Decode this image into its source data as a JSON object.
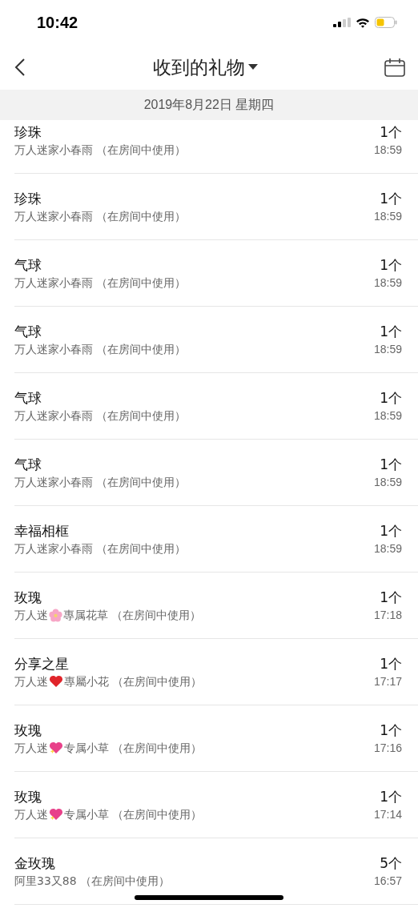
{
  "status_bar": {
    "time": "10:42"
  },
  "nav": {
    "title": "收到的礼物"
  },
  "date_header": "2019年8月22日 星期四",
  "gifts": [
    {
      "name": "珍珠",
      "from": [
        {
          "kind": "text",
          "text": "万人迷家小春雨 （在房间中使用）"
        }
      ],
      "count": "1个",
      "time": "18:59"
    },
    {
      "name": "珍珠",
      "from": [
        {
          "kind": "text",
          "text": "万人迷家小春雨 （在房间中使用）"
        }
      ],
      "count": "1个",
      "time": "18:59"
    },
    {
      "name": "气球",
      "from": [
        {
          "kind": "text",
          "text": "万人迷家小春雨 （在房间中使用）"
        }
      ],
      "count": "1个",
      "time": "18:59"
    },
    {
      "name": "气球",
      "from": [
        {
          "kind": "text",
          "text": "万人迷家小春雨 （在房间中使用）"
        }
      ],
      "count": "1个",
      "time": "18:59"
    },
    {
      "name": "气球",
      "from": [
        {
          "kind": "text",
          "text": "万人迷家小春雨 （在房间中使用）"
        }
      ],
      "count": "1个",
      "time": "18:59"
    },
    {
      "name": "气球",
      "from": [
        {
          "kind": "text",
          "text": "万人迷家小春雨 （在房间中使用）"
        }
      ],
      "count": "1个",
      "time": "18:59"
    },
    {
      "name": "幸福相框",
      "from": [
        {
          "kind": "text",
          "text": "万人迷家小春雨 （在房间中使用）"
        }
      ],
      "count": "1个",
      "time": "18:59"
    },
    {
      "name": "玫瑰",
      "from": [
        {
          "kind": "text",
          "text": "万人迷"
        },
        {
          "kind": "flower"
        },
        {
          "kind": "text",
          "text": "專属花草 （在房间中使用）"
        }
      ],
      "count": "1个",
      "time": "17:18"
    },
    {
      "name": "分享之星",
      "from": [
        {
          "kind": "text",
          "text": "万人迷"
        },
        {
          "kind": "heart"
        },
        {
          "kind": "text",
          "text": "專屬小花 （在房间中使用）"
        }
      ],
      "count": "1个",
      "time": "17:17"
    },
    {
      "name": "玫瑰",
      "from": [
        {
          "kind": "text",
          "text": "万人迷"
        },
        {
          "kind": "sparkle-heart"
        },
        {
          "kind": "text",
          "text": "专属小草 （在房间中使用）"
        }
      ],
      "count": "1个",
      "time": "17:16"
    },
    {
      "name": "玫瑰",
      "from": [
        {
          "kind": "text",
          "text": "万人迷"
        },
        {
          "kind": "sparkle-heart"
        },
        {
          "kind": "text",
          "text": "专属小草 （在房间中使用）"
        }
      ],
      "count": "1个",
      "time": "17:14"
    },
    {
      "name": "金玫瑰",
      "from": [
        {
          "kind": "text",
          "text": "阿里33又88 （在房间中使用）"
        }
      ],
      "count": "5个",
      "time": "16:57"
    }
  ]
}
